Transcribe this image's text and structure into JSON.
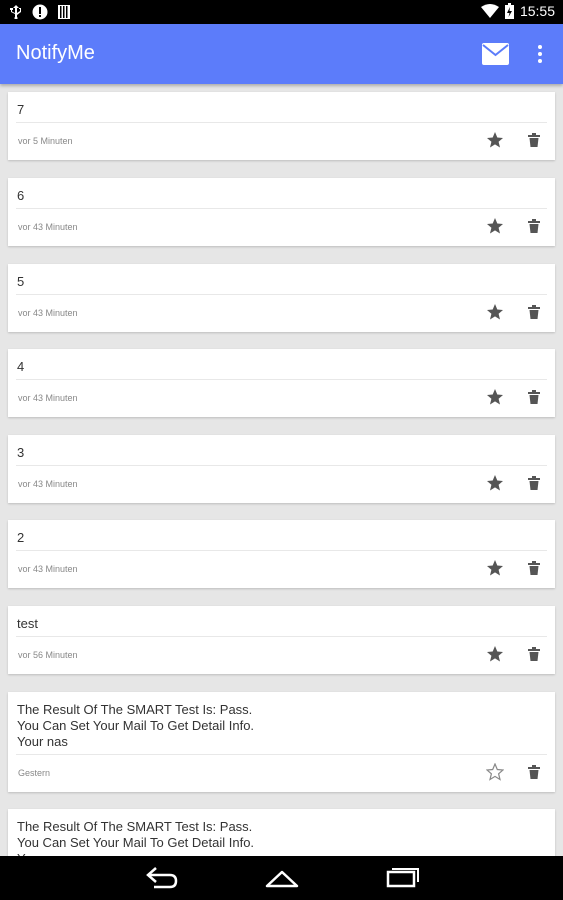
{
  "status_bar": {
    "time": "15:55",
    "icons": [
      "usb-icon",
      "warning-icon",
      "storage-icon",
      "wifi-icon",
      "battery-icon"
    ]
  },
  "app_bar": {
    "title": "NotifyMe",
    "color": "#5c7cfa"
  },
  "notifications": [
    {
      "message": "7",
      "time": "vor 5 Minuten",
      "starred": true
    },
    {
      "message": "6",
      "time": "vor 43 Minuten",
      "starred": true
    },
    {
      "message": "5",
      "time": "vor 43 Minuten",
      "starred": true
    },
    {
      "message": "4",
      "time": "vor 43 Minuten",
      "starred": true
    },
    {
      "message": "3",
      "time": "vor 43 Minuten",
      "starred": true
    },
    {
      "message": "2",
      "time": "vor 43 Minuten",
      "starred": true
    },
    {
      "message": "test",
      "time": "vor 56 Minuten",
      "starred": true
    },
    {
      "message": "The Result Of The SMART Test Is: Pass.\nYou Can Set Your Mail To Get Detail Info.\nYour nas",
      "time": "Gestern",
      "starred": false
    },
    {
      "message": "The Result Of The SMART Test Is: Pass.\nYou Can Set Your Mail To Get Detail Info.\nYour nas",
      "time": "",
      "starred": false
    }
  ]
}
